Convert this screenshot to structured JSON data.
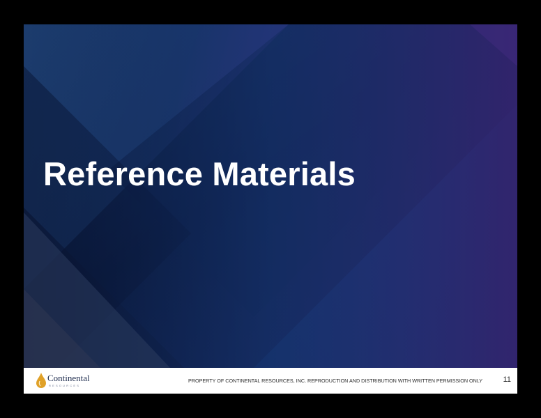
{
  "slide": {
    "title": "Reference Materials",
    "colors": {
      "background_dark": "#0b1633",
      "accent_blue": "#1b3d7a",
      "accent_purple": "#3b2a78",
      "footer_text": "#2b2b2b",
      "logo_gold": "#e0a128",
      "logo_navy": "#1f2d4f"
    }
  },
  "footer": {
    "logo": {
      "name": "Continental",
      "subtitle": "RESOURCES",
      "icon": "oil-drop-icon"
    },
    "copyright": "PROPERTY OF CONTINENTAL RESOURCES, INC. REPRODUCTION AND DISTRIBUTION WITH WRITTEN PERMISSION ONLY",
    "page_number": "11"
  }
}
